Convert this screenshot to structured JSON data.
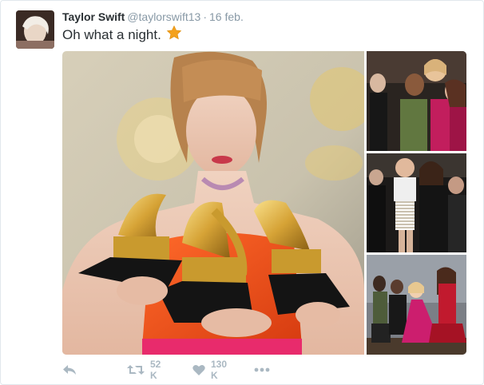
{
  "tweet": {
    "author_name": "Taylor Swift",
    "handle": "@taylorswift13",
    "separator": "·",
    "date": "16 feb.",
    "text": "Oh what a night.",
    "emoji": "star-emoji"
  },
  "actions": {
    "retweet_count": "52 K",
    "like_count": "130 K"
  },
  "colors": {
    "text": "#292f33",
    "muted": "#8899a6",
    "action_gray": "#aab8c2",
    "star": "#f4a11c"
  }
}
